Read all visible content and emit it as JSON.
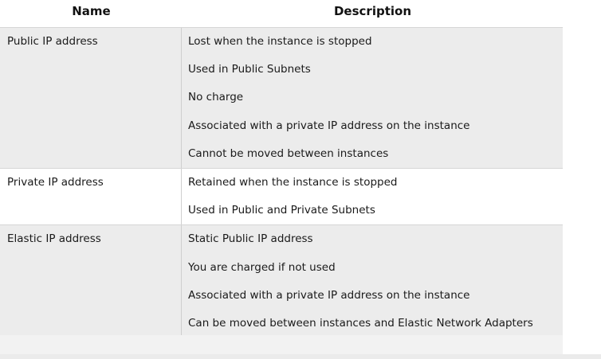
{
  "table": {
    "headers": {
      "name": "Name",
      "description": "Description"
    },
    "rows": [
      {
        "name": "Public IP address",
        "descriptions": [
          "Lost when the instance is stopped",
          "Used in Public Subnets",
          "No charge",
          "Associated with a private IP address on the instance",
          "Cannot be moved between instances"
        ]
      },
      {
        "name": "Private IP address",
        "descriptions": [
          "Retained when the instance is stopped",
          "Used in Public and Private Subnets"
        ]
      },
      {
        "name": "Elastic IP address",
        "descriptions": [
          "Static Public IP address",
          "You are charged if not used",
          "Associated with a private IP address on the instance",
          "Can be moved between instances and Elastic Network Adapters"
        ]
      }
    ]
  },
  "colors": {
    "shaded_row": "#ececec",
    "plain_row": "#ffffff",
    "divider": "#d6d6d6"
  }
}
